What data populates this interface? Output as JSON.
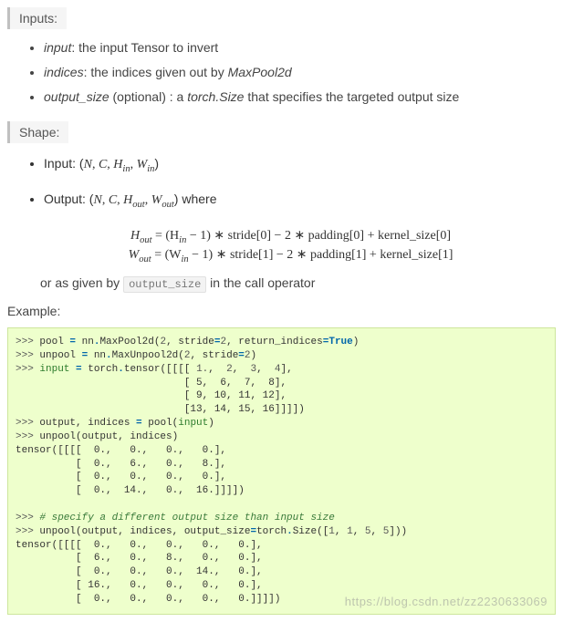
{
  "sections": {
    "inputs": {
      "label": "Inputs:",
      "items": [
        {
          "name": "input",
          "desc": ": the input Tensor to invert"
        },
        {
          "name": "indices",
          "desc": ": the indices given out by ",
          "ref": "MaxPool2d"
        },
        {
          "name": "output_size",
          "optional": " (optional) : a ",
          "ref": "torch.Size",
          "tail": " that specifies the targeted output size"
        }
      ]
    },
    "shape": {
      "label": "Shape:",
      "input_prefix": "Input: (",
      "output_prefix": "Output: (",
      "tuple_close": ")",
      "where": " where",
      "N": "N",
      "C": "C",
      "Hin": "H",
      "Win": "W",
      "Hout": "H",
      "Wout": "W",
      "sub_in": "in",
      "sub_out": "out",
      "formula_h": " = (H",
      "formula_h_tail": " − 1) ∗ stride[0] − 2 ∗ padding[0] + kernel_size[0]",
      "formula_w": " = (W",
      "formula_w_tail": " − 1) ∗ stride[1] − 2 ∗ padding[1] + kernel_size[1]",
      "or_prefix": "or as given by ",
      "or_code": "output_size",
      "or_suffix": " in the call operator"
    },
    "example_label": "Example:"
  },
  "code": {
    "l1_a": ">>> ",
    "l1_b": "pool ",
    "l1_c": "=",
    "l1_d": " nn",
    "l1_e": ".",
    "l1_f": "MaxPool2d(",
    "l1_g": "2",
    "l1_h": ", stride",
    "l1_i": "=",
    "l1_j": "2",
    "l1_k": ", return_indices",
    "l1_l": "=",
    "l1_m": "True",
    "l1_n": ")",
    "l2_a": ">>> ",
    "l2_b": "unpool ",
    "l2_c": "=",
    "l2_d": " nn",
    "l2_e": ".",
    "l2_f": "MaxUnpool2d(",
    "l2_g": "2",
    "l2_h": ", stride",
    "l2_i": "=",
    "l2_j": "2",
    "l2_k": ")",
    "l3_a": ">>> ",
    "l3_b": "input ",
    "l3_c": "=",
    "l3_d": " torch",
    "l3_e": ".",
    "l3_f": "tensor([[[[ ",
    "l3_g": "1.",
    "l3_h": ",  ",
    "l3_i": "2",
    "l3_j": ",  ",
    "l3_k": "3",
    "l3_l": ",  ",
    "l3_m": "4",
    "l3_n": "],",
    "l4": "                            [ 5,  6,  7,  8],",
    "l5": "                            [ 9, 10, 11, 12],",
    "l6": "                            [13, 14, 15, 16]]]])",
    "l7_a": ">>> ",
    "l7_b": "output, indices ",
    "l7_c": "=",
    "l7_d": " pool(",
    "l7_e": "input",
    "l7_f": ")",
    "l8_a": ">>> ",
    "l8_b": "unpool(output, indices)",
    "l9": "tensor([[[[  0.,   0.,   0.,   0.],",
    "l10": "          [  0.,   6.,   0.,   8.],",
    "l11": "          [  0.,   0.,   0.,   0.],",
    "l12": "          [  0.,  14.,   0.,  16.]]]])",
    "blank": "",
    "l13_a": ">>> ",
    "l13_b": "# specify a different output size than input size",
    "l14_a": ">>> ",
    "l14_b": "unpool(output, indices, output_size",
    "l14_c": "=",
    "l14_d": "torch",
    "l14_e": ".",
    "l14_f": "Size([",
    "l14_g": "1",
    "l14_h": ", ",
    "l14_i": "1",
    "l14_j": ", ",
    "l14_k": "5",
    "l14_l": ", ",
    "l14_m": "5",
    "l14_n": "]))",
    "l15": "tensor([[[[  0.,   0.,   0.,   0.,   0.],",
    "l16": "          [  6.,   0.,   8.,   0.,   0.],",
    "l17": "          [  0.,   0.,   0.,  14.,   0.],",
    "l18": "          [ 16.,   0.,   0.,   0.,   0.],",
    "l19": "          [  0.,   0.,   0.,   0.,   0.]]]])"
  },
  "watermark": "https://blog.csdn.net/zz2230633069"
}
